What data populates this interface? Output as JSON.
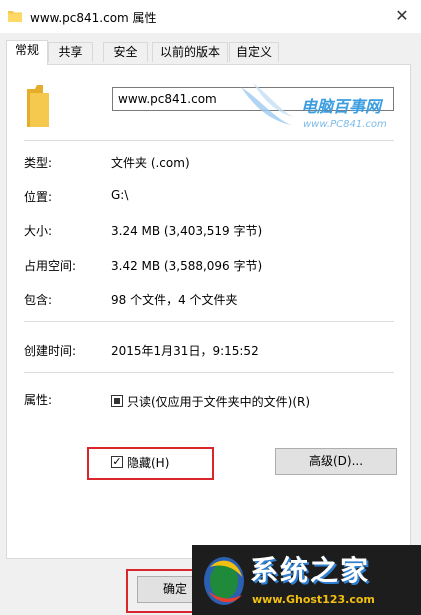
{
  "window": {
    "title": "www.pc841.com 属性",
    "close_glyph": "✕"
  },
  "tabs": [
    {
      "label": "常规",
      "active": true
    },
    {
      "label": "共享",
      "active": false
    },
    {
      "label": "安全",
      "active": false
    },
    {
      "label": "以前的版本",
      "active": false
    },
    {
      "label": "自定义",
      "active": false
    }
  ],
  "general": {
    "folder_name": "www.pc841.com",
    "properties": [
      {
        "label": "类型:",
        "value": "文件夹 (.com)"
      },
      {
        "label": "位置:",
        "value": "G:\\"
      },
      {
        "label": "大小:",
        "value": "3.24 MB (3,403,519 字节)"
      },
      {
        "label": "占用空间:",
        "value": "3.42 MB (3,588,096 字节)"
      },
      {
        "label": "包含:",
        "value": "98 个文件，4 个文件夹"
      }
    ],
    "created": {
      "label": "创建时间:",
      "value": "2015年1月31日，9:15:52"
    },
    "attributes": {
      "label": "属性:",
      "readonly_label": "只读(仅应用于文件夹中的文件)(R)",
      "readonly_state": "indeterminate",
      "hidden_label": "隐藏(H)",
      "hidden_checked": true,
      "advanced_button": "高级(D)..."
    }
  },
  "footer": {
    "ok_button": "确定"
  },
  "watermark": {
    "title": "电脑百事网",
    "url": "www.PC841.com"
  },
  "logo": {
    "title": "系统之家",
    "url": "www.Ghost123.com"
  },
  "colors": {
    "highlight": "#d8262c",
    "folder": "#f5c94e",
    "accent": "#3c9ee0"
  },
  "icons": {
    "title_icon": "folder-icon",
    "big_icon": "folder-icon",
    "close": "close-icon"
  }
}
